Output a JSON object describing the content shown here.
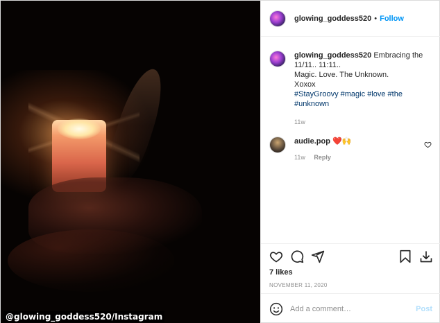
{
  "photo": {
    "credit": "@glowing_goddess520/Instagram"
  },
  "header": {
    "username": "glowing_goddess520",
    "separator": "•",
    "follow_label": "Follow"
  },
  "caption": {
    "username": "glowing_goddess520",
    "line1": "Embracing the 11/11.. 11:11..",
    "line2": "Magic. Love. The Unknown.",
    "line3": "Xoxox",
    "hashtags": [
      "#StayGroovy",
      "#magic",
      "#love",
      "#the",
      "#unknown"
    ],
    "time": "11w"
  },
  "comment": {
    "username": "audie.pop",
    "text": "❤️🙌",
    "time": "11w",
    "reply_label": "Reply"
  },
  "actions": {
    "likes": "7 likes",
    "date": "NOVEMBER 11, 2020"
  },
  "add_comment": {
    "placeholder": "Add a comment…",
    "post_label": "Post"
  },
  "icons": {
    "like": "heart-icon",
    "comment": "comment-icon",
    "share": "share-icon",
    "save": "bookmark-icon",
    "download": "download-icon",
    "emoji": "emoji-icon",
    "comment_like": "heart-icon"
  },
  "colors": {
    "accent": "#0095f6",
    "hashtag": "#00376b",
    "muted": "#8e8e8e",
    "post_disabled": "#b2dffc"
  }
}
